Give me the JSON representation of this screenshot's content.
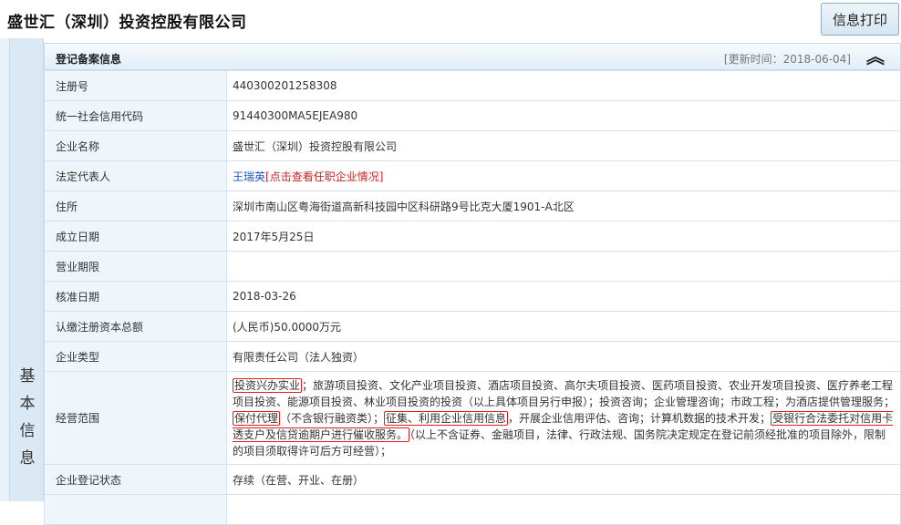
{
  "header": {
    "company_title": "盛世汇（深圳）投资控股有限公司",
    "print_button": "信息打印"
  },
  "side_tab": {
    "label": "基本信息"
  },
  "panel": {
    "title": "登记备案信息",
    "updated": "[更新时间：2018-06-04]",
    "collapse_icon": "︽"
  },
  "rows": {
    "reg_no": {
      "label": "注册号",
      "value": "440300201258308"
    },
    "credit_code": {
      "label": "统一社会信用代码",
      "value": "91440300MA5EJEA980"
    },
    "name": {
      "label": "企业名称",
      "value": "盛世汇（深圳）投资控股有限公司"
    },
    "rep": {
      "label": "法定代表人",
      "value": "王瑞英",
      "link": "[点击查看任职企业情况]"
    },
    "address": {
      "label": "住所",
      "value": "深圳市南山区粤海街道高新科技园中区科研路9号比克大厦1901-A北区"
    },
    "founded": {
      "label": "成立日期",
      "value": "2017年5月25日"
    },
    "term": {
      "label": "营业期限",
      "value": ""
    },
    "approved": {
      "label": "核准日期",
      "value": "2018-03-26"
    },
    "capital": {
      "label": "认缴注册资本总额",
      "value": "(人民币)50.0000万元"
    },
    "type": {
      "label": "企业类型",
      "value": "有限责任公司（法人独资）"
    },
    "scope": {
      "label": "经营范围",
      "s1": "投资兴办实业",
      "t1": "；旅游项目投资、文化产业项目投资、酒店项目投资、高尔夫项目投资、医药项目投资、农业开发项目投资、医疗养老工程项目投资、能源项目投资、林业项目投资的投资（以上具体项目另行申报）；投资咨询；企业管理咨询；市政工程；为酒店提供管理服务；",
      "s2": "保付代理",
      "t2": "（不含银行融资类）；",
      "s3": "征集、利用企业信用信息",
      "t3": "，开展企业信用评估、咨询；计算机数据的技术开发；",
      "s4": "受银行合法委托对信用卡透支户及信贷逾期户进行催收服务。",
      "t4": "（以上不含证券、金融项目，法律、行政法规、国务院决定规定在登记前须经批准的项目除外，限制的项目须取得许可后方可经营）；"
    },
    "status": {
      "label": "企业登记状态",
      "value": "存续（在营、开业、在册）"
    }
  }
}
